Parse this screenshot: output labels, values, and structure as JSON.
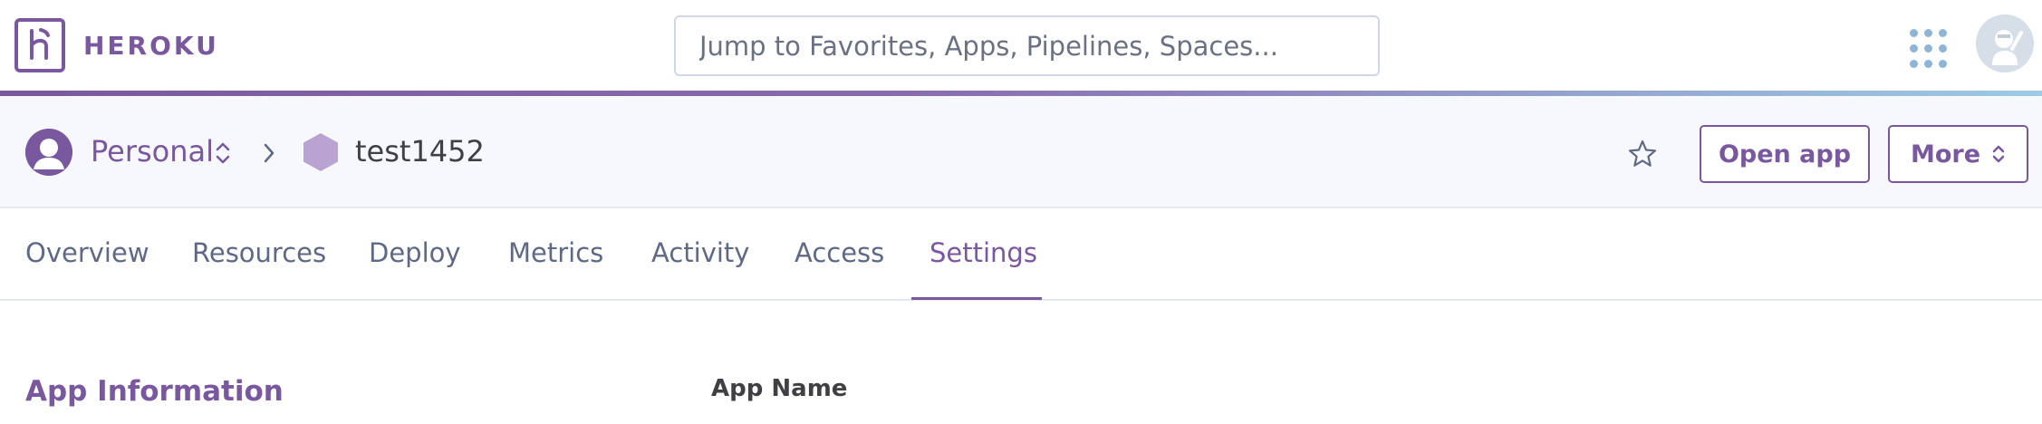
{
  "brand": {
    "name": "HEROKU",
    "logo_icon": "heroku-logo-icon"
  },
  "search": {
    "placeholder": "Jump to Favorites, Apps, Pipelines, Spaces..."
  },
  "header": {
    "apps_icon": "apps-grid-icon",
    "avatar_icon": "user-avatar-icon"
  },
  "breadcrumb": {
    "owner": "Personal",
    "owner_icon": "user-circle-icon",
    "separator_icon": "chevron-right-icon",
    "app_icon": "hexagon-icon",
    "app": "test1452"
  },
  "actions": {
    "favorite_icon": "star-icon",
    "open_app": "Open app",
    "more": "More"
  },
  "tabs": [
    {
      "label": "Overview"
    },
    {
      "label": "Resources"
    },
    {
      "label": "Deploy"
    },
    {
      "label": "Metrics"
    },
    {
      "label": "Activity"
    },
    {
      "label": "Access"
    },
    {
      "label": "Settings",
      "active": true
    }
  ],
  "content": {
    "section_title": "App Information",
    "field_label": "App Name"
  },
  "colors": {
    "accent": "#79589f",
    "link_blue": "#8fb5d6",
    "page_bg": "#ffffff",
    "subheader_bg": "#f7f8fb"
  }
}
